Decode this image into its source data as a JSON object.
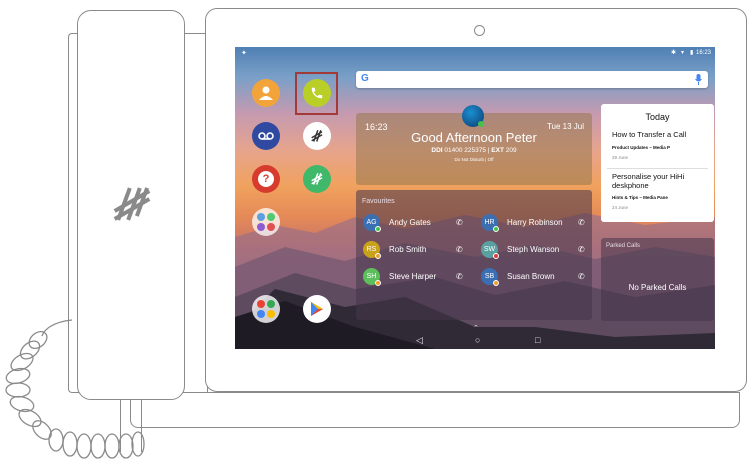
{
  "status_bar": {
    "time": "16:23"
  },
  "search": {
    "placeholder": ""
  },
  "greeting": {
    "time": "16:23",
    "date": "Tue 13 Jul",
    "message": "Good Afternoon Peter",
    "ddi_label": "DDI",
    "ddi_number": "01400 225375",
    "ext_label": "EXT",
    "ext_number": "209",
    "dnd": "Do Not Disturb | Off"
  },
  "favourites": {
    "title": "Favourites",
    "contacts": [
      {
        "initials": "AG",
        "name": "Andy Gates",
        "avatar_color": "#3b6fb3",
        "status_color": "#44c24a"
      },
      {
        "initials": "HR",
        "name": "Harry Robinson",
        "avatar_color": "#3d6eb0",
        "status_color": "#44c24a"
      },
      {
        "initials": "RS",
        "name": "Rob Smith",
        "avatar_color": "#c9a21c",
        "status_color": "#f0a030"
      },
      {
        "initials": "SW",
        "name": "Steph Wanson",
        "avatar_color": "#5aa0a0",
        "status_color": "#e03a3a"
      },
      {
        "initials": "SH",
        "name": "Steve Harper",
        "avatar_color": "#5cbf5c",
        "status_color": "#f0a030"
      },
      {
        "initials": "SB",
        "name": "Susan Brown",
        "avatar_color": "#3b6fb3",
        "status_color": "#f0a030"
      }
    ]
  },
  "today": {
    "title": "Today",
    "items": [
      {
        "title": "How to Transfer a Call",
        "source": "Product Updates – Media P",
        "date": "29 June"
      },
      {
        "title": "Personalise your HiHi deskphone",
        "source": "Hints & Tips – Media Pane",
        "date": "24 June"
      }
    ]
  },
  "parked": {
    "title": "Parked Calls",
    "empty_message": "No Parked Calls"
  },
  "colors": {
    "phone_app": "#b9cf28",
    "contacts_app": "#f2a43a",
    "voicemail_app": "#2f4aa0",
    "help_app": "#d63b2e",
    "selection": "#a23a3a"
  }
}
